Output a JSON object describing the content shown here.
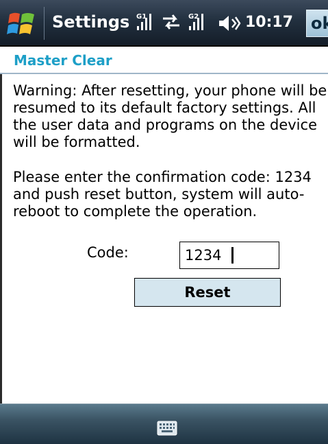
{
  "title_bar": {
    "app_title": "Settings",
    "time": "10:17",
    "ok_label": "ok",
    "icons": [
      "windows-start-icon",
      "signal-line1-icon",
      "data-connection-icon",
      "signal-line2-icon",
      "volume-icon"
    ]
  },
  "page": {
    "title": "Master Clear",
    "warning": "Warning: After resetting, your phone will be resumed to its default factory settings. All the user data and programs on the device will be formatted.",
    "instructions": "Please enter the confirmation code: 1234 and push reset button, system will auto-reboot to complete the operation.",
    "code_label": "Code:",
    "code_value": "1234",
    "reset_label": "Reset"
  },
  "bottom_bar": {
    "icons": [
      "keyboard-icon"
    ]
  },
  "colors": {
    "title_bar_bg": "#22303f",
    "page_title": "#1d9fc7",
    "reset_bg": "#d5e6ef",
    "bottom_bar_bg": "#3a5363"
  }
}
